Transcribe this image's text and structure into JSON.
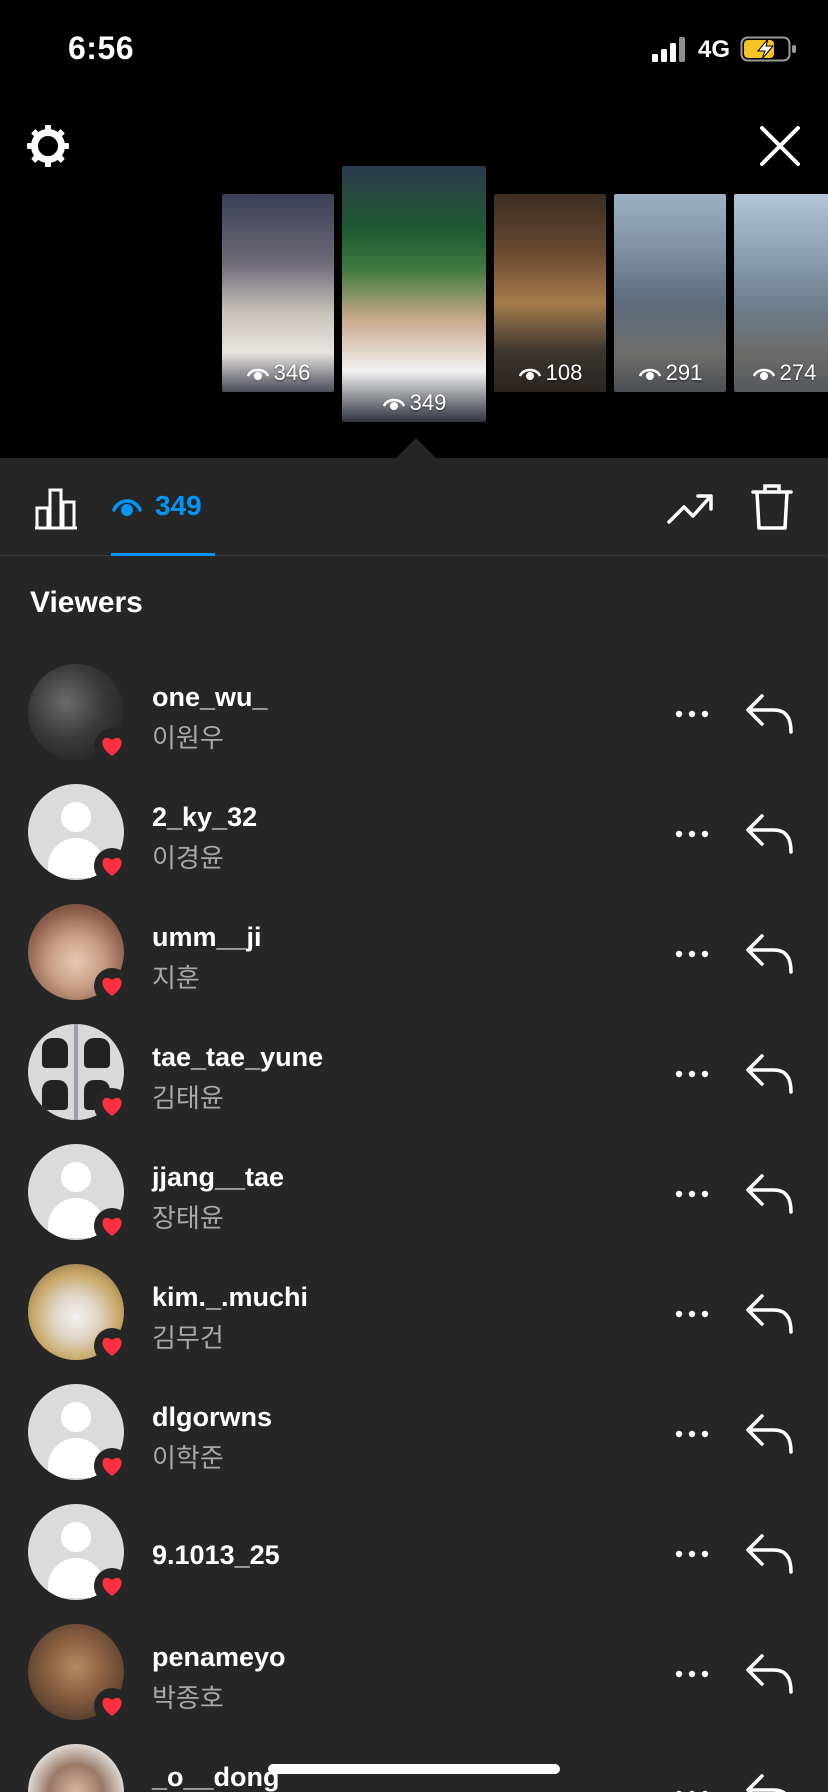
{
  "status": {
    "time": "6:56",
    "network": "4G"
  },
  "stories": [
    {
      "views": "346"
    },
    {
      "views": "349"
    },
    {
      "views": "108"
    },
    {
      "views": "291"
    },
    {
      "views": "274"
    }
  ],
  "tabs": {
    "viewers_count": "349"
  },
  "section_title": "Viewers",
  "viewers": [
    {
      "username": "one_wu_",
      "name": "이원우",
      "avatar": "photo-a"
    },
    {
      "username": "2_ky_32",
      "name": "이경윤",
      "avatar": "default"
    },
    {
      "username": "umm__ji",
      "name": "지훈",
      "avatar": "photo-b"
    },
    {
      "username": "tae_tae_yune",
      "name": "김태윤",
      "avatar": "photo-c"
    },
    {
      "username": "jjang__tae",
      "name": "장태윤",
      "avatar": "default"
    },
    {
      "username": "kim._.muchi",
      "name": "김무건",
      "avatar": "photo-d"
    },
    {
      "username": "dlgorwns",
      "name": "이학준",
      "avatar": "default"
    },
    {
      "username": "9.1013_25",
      "name": "",
      "avatar": "default"
    },
    {
      "username": "penameyo",
      "name": "박종호",
      "avatar": "photo-e"
    },
    {
      "username": "_o__dong",
      "name": "",
      "avatar": "photo-f"
    }
  ],
  "colors": {
    "accent": "#0095f6",
    "heart": "#ff3040",
    "sheet_bg": "#262626"
  }
}
